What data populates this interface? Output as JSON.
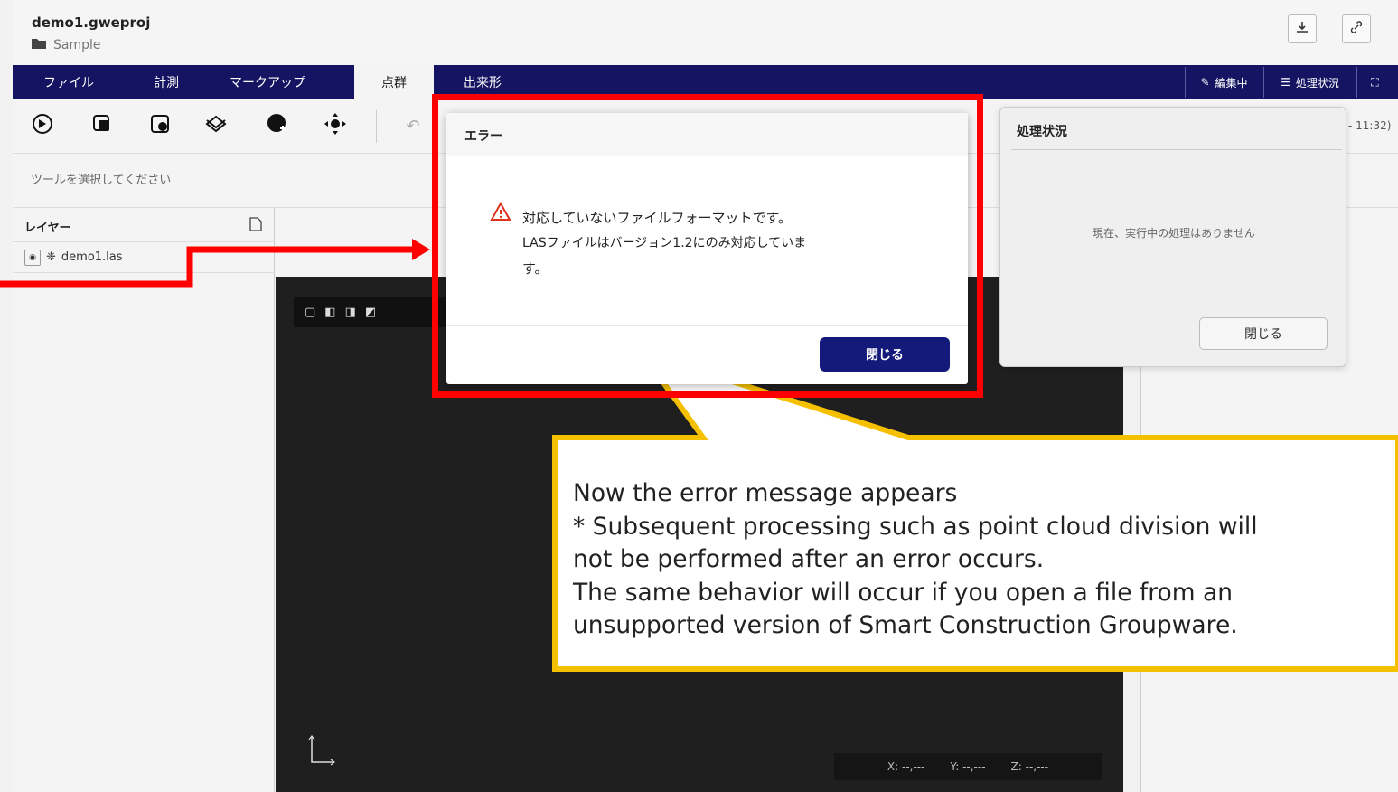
{
  "header": {
    "project_name": "demo1.gweproj",
    "folder": "Sample"
  },
  "menu": {
    "tabs": [
      "ファイル",
      "計測",
      "マークアップ",
      "点群",
      "出来形"
    ],
    "active_tab": "点群",
    "editing_label": "編集中",
    "status_label": "処理状況"
  },
  "toolbar": {
    "hint": "ツールを選択してください"
  },
  "layers": {
    "title": "レイヤー",
    "items": [
      {
        "name": "demo1.las"
      }
    ]
  },
  "viewer": {
    "x": "X: --,---",
    "y": "Y: --,---",
    "z": "Z: --,---"
  },
  "status_popup": {
    "title": "処理状況",
    "empty_text": "現在、実行中の処理はありません",
    "close_label": "閉じる",
    "time_tail": "- 11:32)"
  },
  "error_dialog": {
    "title": "エラー",
    "line1": "対応していないファイルフォーマットです。",
    "line2": "LASファイルはバージョン1.2にのみ対応していま",
    "line3": "す。",
    "close_label": "閉じる"
  },
  "annotation": {
    "lines": [
      "Now the error message appears",
      "* Subsequent processing such as point cloud division will",
      "not be performed after an error occurs.",
      "The same behavior will occur if you open a file from an",
      "unsupported version of Smart Construction Groupware."
    ]
  },
  "colors": {
    "menubar": "#141462",
    "primary_button": "#141a7a",
    "highlight_frame": "#ff0000",
    "callout_border": "#f5c000"
  }
}
